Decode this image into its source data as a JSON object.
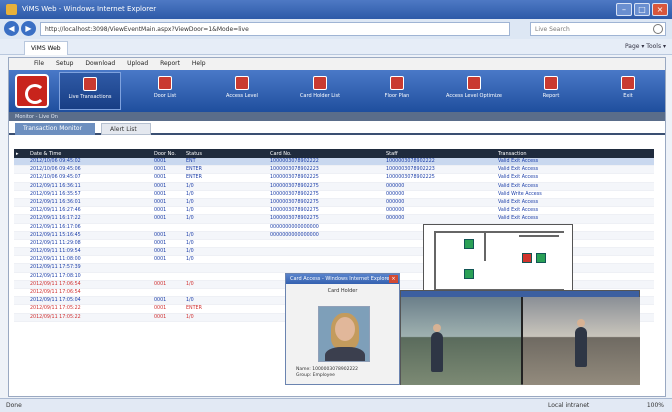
{
  "window": {
    "title": "ViMS Web - Windows Internet Explorer"
  },
  "browser": {
    "url": "http://localhost:3098/ViewEventMain.aspx?ViewDoor=1&Mode=live",
    "search_placeholder": "Live Search",
    "tab_label": "ViMS Web",
    "tools": [
      "Page",
      "Tools"
    ]
  },
  "app": {
    "menu": [
      "File",
      "Setup",
      "Download",
      "Upload",
      "Report",
      "Help"
    ],
    "toolbar": [
      {
        "label": "Live Transactions",
        "active": true
      },
      {
        "label": "Door List",
        "active": false
      },
      {
        "label": "Access Level",
        "active": false
      },
      {
        "label": "Card Holder List",
        "active": false
      },
      {
        "label": "Floor Plan",
        "active": false
      },
      {
        "label": "Access Level Optimize",
        "active": false
      },
      {
        "label": "Report",
        "active": false
      },
      {
        "label": "Exit",
        "active": false
      }
    ],
    "status_strip": "Monitor - Live On",
    "subtabs": [
      "Transaction Monitor",
      "Alert List"
    ]
  },
  "grid": {
    "headers": [
      "Date & Time",
      "Door No.",
      "Status",
      "Card No.",
      "Staff",
      "Transaction"
    ],
    "rows": [
      {
        "dt": "2012/10/06 09:45:02",
        "ch": "0001",
        "st": "ENT",
        "card": "1000003078902222",
        "user": "1000003078902222",
        "tr": "Valid Exit Access",
        "cls": "sel"
      },
      {
        "dt": "2012/10/06 09:45:06",
        "ch": "0001",
        "st": "ENTER",
        "card": "1000003078902223",
        "user": "1000003078902223",
        "tr": "Valid Exit Access",
        "cls": ""
      },
      {
        "dt": "2012/10/06 09:45:07",
        "ch": "0001",
        "st": "ENTER",
        "card": "1000003078902225",
        "user": "1000003078902225",
        "tr": "Valid Exit Access",
        "cls": ""
      },
      {
        "dt": "2012/09/11 16:36:11",
        "ch": "0001",
        "st": "1/0",
        "card": "1000003078902275",
        "user": "000000",
        "tr": "Valid Exit Access",
        "cls": ""
      },
      {
        "dt": "2012/09/11 16:35:57",
        "ch": "0001",
        "st": "1/0",
        "card": "1000003078902275",
        "user": "000000",
        "tr": "Valid Write Access",
        "cls": ""
      },
      {
        "dt": "2012/09/11 16:36:01",
        "ch": "0001",
        "st": "1/0",
        "card": "1000003078902275",
        "user": "000000",
        "tr": "Valid Exit Access",
        "cls": ""
      },
      {
        "dt": "2012/09/11 16:27:46",
        "ch": "0001",
        "st": "1/0",
        "card": "1000003078902275",
        "user": "000000",
        "tr": "Valid Exit Access",
        "cls": ""
      },
      {
        "dt": "2012/09/11 16:17:22",
        "ch": "0001",
        "st": "1/0",
        "card": "1000003078902275",
        "user": "000000",
        "tr": "Valid Exit Access",
        "cls": ""
      },
      {
        "dt": "2012/09/11 16:17:06",
        "ch": "",
        "st": "",
        "card": "0000000000000000",
        "user": "",
        "tr": "",
        "cls": ""
      },
      {
        "dt": "2012/09/11 15:16:45",
        "ch": "0001",
        "st": "1/0",
        "card": "0000000000000000",
        "user": "",
        "tr": "",
        "cls": ""
      },
      {
        "dt": "2012/09/11 11:29:08",
        "ch": "0001",
        "st": "1/0",
        "card": "",
        "user": "",
        "tr": "",
        "cls": ""
      },
      {
        "dt": "2012/09/11 11:09:54",
        "ch": "0001",
        "st": "1/0",
        "card": "",
        "user": "",
        "tr": "",
        "cls": ""
      },
      {
        "dt": "2012/09/11 11:08:00",
        "ch": "0001",
        "st": "1/0",
        "card": "",
        "user": "",
        "tr": "",
        "cls": ""
      },
      {
        "dt": "2012/09/11 17:57:39",
        "ch": "",
        "st": "",
        "card": "",
        "user": "",
        "tr": "",
        "cls": ""
      },
      {
        "dt": "2012/09/11 17:08:10",
        "ch": "",
        "st": "",
        "card": "",
        "user": "",
        "tr": "",
        "cls": ""
      },
      {
        "dt": "2012/09/11 17:06:54",
        "ch": "0001",
        "st": "1/0",
        "card": "",
        "user": "",
        "tr": "",
        "cls": "red"
      },
      {
        "dt": "2012/09/11 17:06:54",
        "ch": "",
        "st": "",
        "card": "",
        "user": "",
        "tr": "",
        "cls": "red"
      },
      {
        "dt": "2012/09/11 17:05:04",
        "ch": "0001",
        "st": "1/0",
        "card": "",
        "user": "",
        "tr": "",
        "cls": ""
      },
      {
        "dt": "2012/09/11 17:05:22",
        "ch": "0001",
        "st": "ENTER",
        "card": "",
        "user": "",
        "tr": "",
        "cls": "red"
      },
      {
        "dt": "2012/09/11 17:05:22",
        "ch": "0001",
        "st": "1/0",
        "card": "",
        "user": "",
        "tr": "",
        "cls": "red"
      }
    ]
  },
  "popup": {
    "title": "Card Access - Windows Internet Explorer",
    "label": "Card Holder",
    "info_name": "Name: 1000003078902222",
    "info_group": "Group: Employee"
  },
  "statusbar": {
    "left": "Done",
    "zone": "Local intranet",
    "zoom": "100%"
  },
  "colors": {
    "toolbar": "#1f4f9e",
    "accent_red": "#c8241c",
    "row_red": "#d03030",
    "row_blue": "#1c3ea8"
  }
}
